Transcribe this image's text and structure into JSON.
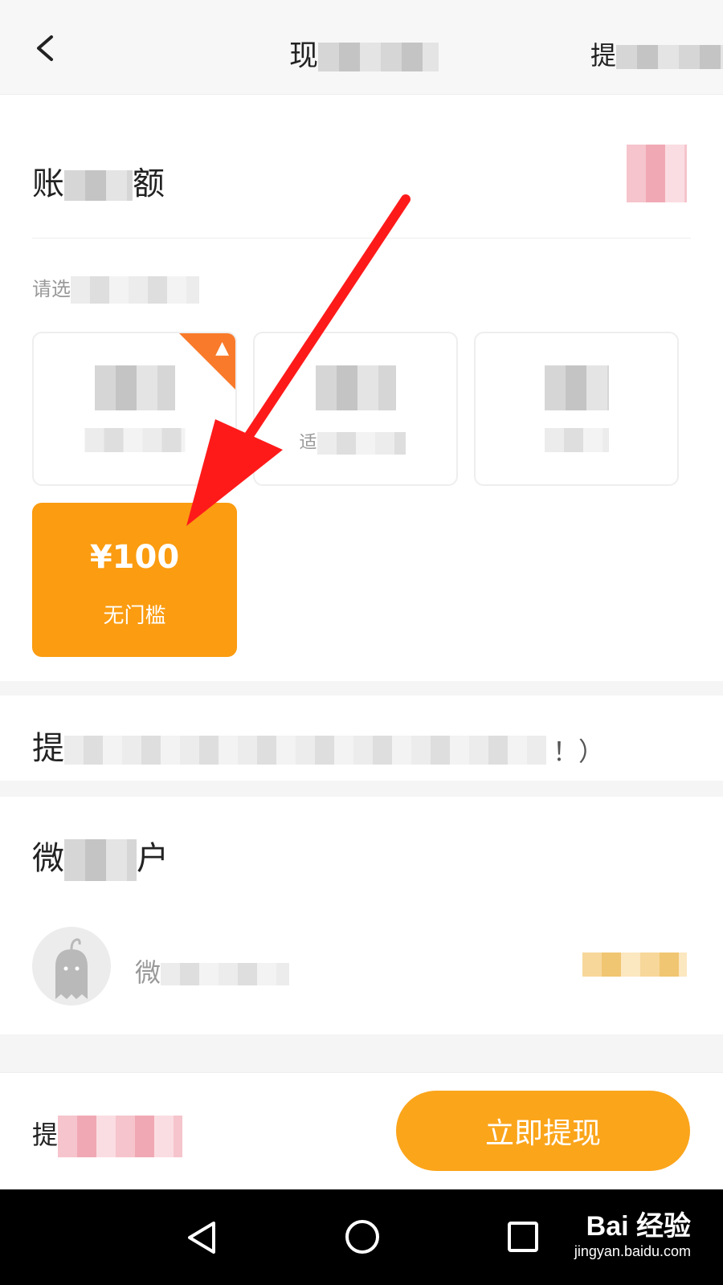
{
  "header": {
    "title": "现",
    "right": "提"
  },
  "balance": {
    "label_start": "账",
    "label_end": "额"
  },
  "options": {
    "prompt": "请选",
    "hot_icon": "flame-icon",
    "card2_sub": "适",
    "selected": {
      "amount": "¥100",
      "subtitle": "无门槛"
    }
  },
  "note": {
    "label_start": "提",
    "label_end": "！）"
  },
  "wechat": {
    "title_start": "微",
    "title_end": "户",
    "account_prefix": "微",
    "status_visible": "去"
  },
  "bottom": {
    "label_start": "提",
    "button_label": "立即提现"
  },
  "watermark": {
    "brand": "Bai 经验",
    "url": "jingyan.baidu.com"
  },
  "colors": {
    "accent": "#fb9c11",
    "hot_tag": "#f97a2a",
    "annotation_arrow": "#ff1a1a"
  }
}
